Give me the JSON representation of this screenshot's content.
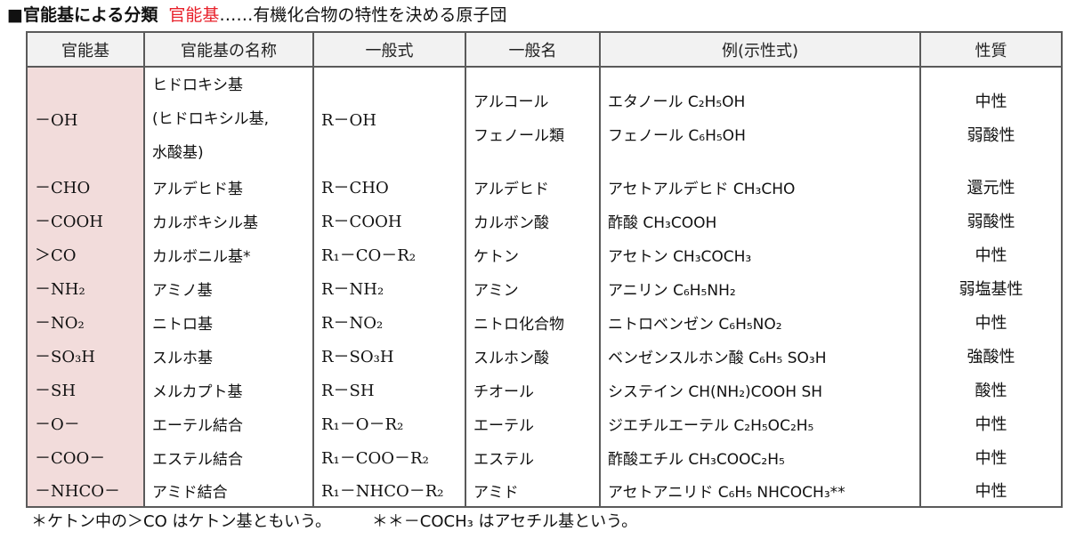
{
  "title": {
    "marker": "■",
    "heading": "官能基による分類",
    "highlight": "官能基",
    "definition": "……有機化合物の特性を決める原子団"
  },
  "table": {
    "headers": [
      "官能基",
      "官能基の名称",
      "一般式",
      "一般名",
      "例(示性式)",
      "性質"
    ],
    "rows": [
      {
        "group": "－OH",
        "name_lines": [
          "ヒドロキシ基",
          "(ヒドロキシル基,",
          "水酸基)"
        ],
        "formula": "R－OH",
        "general_names": [
          "アルコール",
          "フェノール類"
        ],
        "examples": [
          "エタノール C₂H₅OH",
          "フェノール C₆H₅OH"
        ],
        "properties": [
          "中性",
          "弱酸性"
        ]
      },
      {
        "group": "－CHO",
        "name": "アルデヒド基",
        "formula": "R－CHO",
        "general_name": "アルデヒド",
        "example": "アセトアルデヒド CH₃CHO",
        "property": "還元性"
      },
      {
        "group": "－COOH",
        "name": "カルボキシル基",
        "formula": "R－COOH",
        "general_name": "カルボン酸",
        "example": "酢酸 CH₃COOH",
        "property": "弱酸性"
      },
      {
        "group": "＞CO",
        "name": "カルボニル基*",
        "formula": "R₁－CO－R₂",
        "general_name": "ケトン",
        "example": "アセトン CH₃COCH₃",
        "property": "中性"
      },
      {
        "group": "－NH₂",
        "name": "アミノ基",
        "formula": "R－NH₂",
        "general_name": "アミン",
        "example": "アニリン C₆H₅NH₂",
        "property": "弱塩基性"
      },
      {
        "group": "－NO₂",
        "name": "ニトロ基",
        "formula": "R－NO₂",
        "general_name": "ニトロ化合物",
        "example": "ニトロベンゼン C₆H₅NO₂",
        "property": "中性"
      },
      {
        "group": "－SO₃H",
        "name": "スルホ基",
        "formula": "R－SO₃H",
        "general_name": "スルホン酸",
        "example": "ベンゼンスルホン酸 C₆H₅ SO₃H",
        "property": "強酸性"
      },
      {
        "group": "－SH",
        "name": "メルカプト基",
        "formula": "R－SH",
        "general_name": "チオール",
        "example": "システイン CH(NH₂)COOH SH",
        "property": "酸性"
      },
      {
        "group": "－O－",
        "name": "エーテル結合",
        "formula": "R₁－O－R₂",
        "general_name": "エーテル",
        "example": "ジエチルエーテル C₂H₅OC₂H₅",
        "property": "中性"
      },
      {
        "group": "－COO－",
        "name": "エステル結合",
        "formula": "R₁－COO－R₂",
        "general_name": "エステル",
        "example": "酢酸エチル CH₃COOC₂H₅",
        "property": "中性"
      },
      {
        "group": "－NHCO－",
        "name": "アミド結合",
        "formula": "R₁－NHCO－R₂",
        "general_name": "アミド",
        "example": "アセトアニリド C₆H₅ NHCOCH₃**",
        "property": "中性"
      }
    ]
  },
  "footnotes": [
    "＊ケトン中の＞CO はケトン基ともいう。",
    "＊＊－COCH₃ はアセチル基という。"
  ],
  "colors": {
    "highlight": "#e8212b",
    "header_bg": "#f2f2f2",
    "group_column_bg": "#f2dcdb",
    "border": "#5a5a5a"
  }
}
